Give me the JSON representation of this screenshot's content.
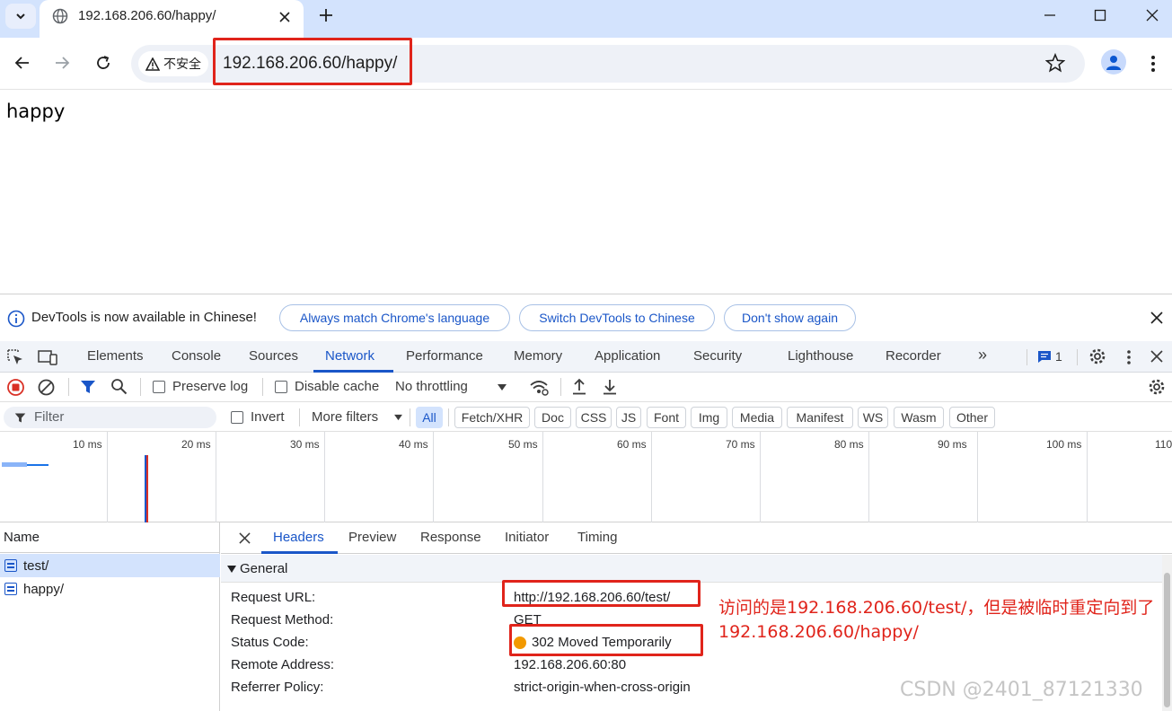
{
  "browser": {
    "tab_title": "192.168.206.60/happy/",
    "security_label": "不安全",
    "url": "192.168.206.60/happy/"
  },
  "page": {
    "body_text": "happy"
  },
  "devtools": {
    "infobar": {
      "message": "DevTools is now available in Chinese!",
      "buttons": [
        "Always match Chrome's language",
        "Switch DevTools to Chinese",
        "Don't show again"
      ]
    },
    "tabs": [
      "Elements",
      "Console",
      "Sources",
      "Network",
      "Performance",
      "Memory",
      "Application",
      "Security",
      "Lighthouse",
      "Recorder"
    ],
    "active_tab": "Network",
    "more_tabs": "»",
    "issues_count": "1",
    "network_toolbar": {
      "preserve_log": "Preserve log",
      "disable_cache": "Disable cache",
      "throttling": "No throttling"
    },
    "filter_bar": {
      "filter_placeholder": "Filter",
      "invert": "Invert",
      "more_filters": "More filters",
      "types": [
        "All",
        "Fetch/XHR",
        "Doc",
        "CSS",
        "JS",
        "Font",
        "Img",
        "Media",
        "Manifest",
        "WS",
        "Wasm",
        "Other"
      ],
      "active_type": "All"
    },
    "timeline": {
      "ticks": [
        "10 ms",
        "20 ms",
        "30 ms",
        "40 ms",
        "50 ms",
        "60 ms",
        "70 ms",
        "80 ms",
        "90 ms",
        "100 ms",
        "110"
      ]
    },
    "requests": {
      "header": "Name",
      "items": [
        "test/",
        "happy/"
      ],
      "selected": "test/"
    },
    "detail": {
      "tabs": [
        "Headers",
        "Preview",
        "Response",
        "Initiator",
        "Timing"
      ],
      "active_tab": "Headers",
      "section": "General",
      "rows": [
        {
          "key": "Request URL:",
          "value": "http://192.168.206.60/test/"
        },
        {
          "key": "Request Method:",
          "value": "GET"
        },
        {
          "key": "Status Code:",
          "value": "302 Moved Temporarily"
        },
        {
          "key": "Remote Address:",
          "value": "192.168.206.60:80"
        },
        {
          "key": "Referrer Policy:",
          "value": "strict-origin-when-cross-origin"
        }
      ],
      "status_color": "#f29900"
    }
  },
  "annotation": {
    "text": "访问的是192.168.206.60/test/，但是被临时重定向到了192.168.206.60/happy/",
    "color": "#e0241b"
  },
  "watermark": "CSDN @2401_87121330"
}
